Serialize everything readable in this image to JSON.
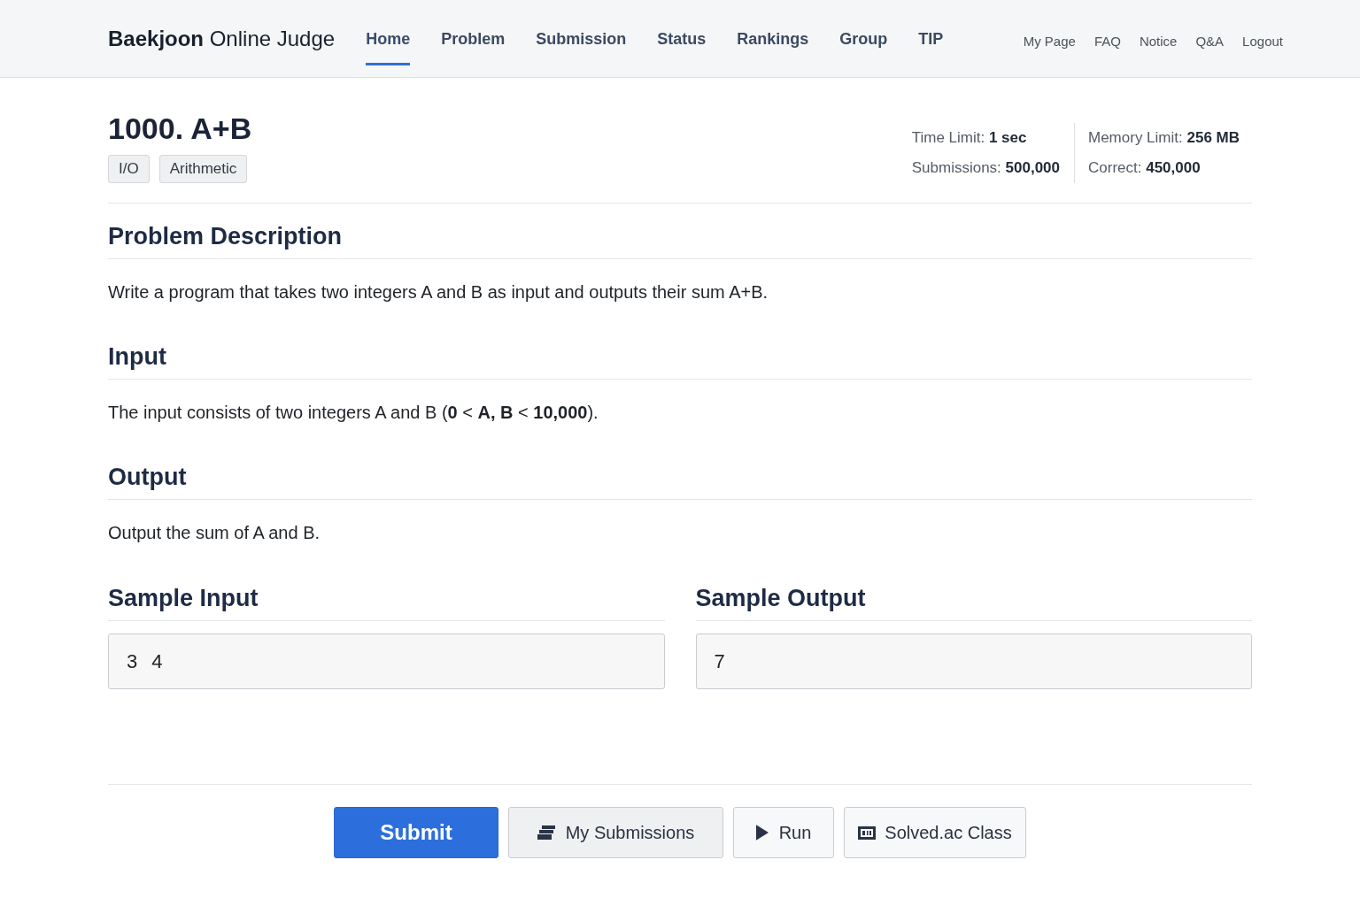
{
  "header": {
    "logo": "**Baekjoon** Online Judge",
    "tabs": [
      {
        "label": "Home",
        "selected": true
      },
      {
        "label": "Problem",
        "selected": false
      },
      {
        "label": "Submission",
        "selected": false
      },
      {
        "label": "Status",
        "selected": false
      },
      {
        "label": "Rankings",
        "selected": false
      },
      {
        "label": "Group",
        "selected": false
      },
      {
        "label": "TIP",
        "selected": false
      }
    ],
    "links": [
      "My Page",
      "FAQ",
      "Notice",
      "Q&A",
      "Logout"
    ]
  },
  "problem": {
    "title": "1000. A+B",
    "tags": [
      "I/O",
      "Arithmetic"
    ],
    "stats": [
      "Time Limit: **1 sec**",
      "Memory Limit: **256 MB**",
      "Submissions: **500,000**",
      "Correct: **450,000**"
    ]
  },
  "sections": [
    {
      "heading": "Problem Description",
      "body": "Write a program that takes two integers A and B as input and outputs their sum A+B."
    },
    {
      "heading": "Input",
      "body": "The input consists of two integers A and B (**0** < **A, B** < **10,000**)."
    },
    {
      "heading": "Output",
      "body": "Output the sum of A and B."
    }
  ],
  "samples": [
    {
      "heading": "Sample Input",
      "value": "3 4"
    },
    {
      "heading": "Sample Output",
      "value": "7"
    }
  ],
  "actions": [
    {
      "kind": "primary",
      "label": "Submit"
    },
    {
      "kind": "submissions",
      "label": "My Submissions"
    },
    {
      "kind": "run",
      "label": "Run"
    },
    {
      "kind": "class",
      "label": "Solved.ac Class"
    }
  ]
}
